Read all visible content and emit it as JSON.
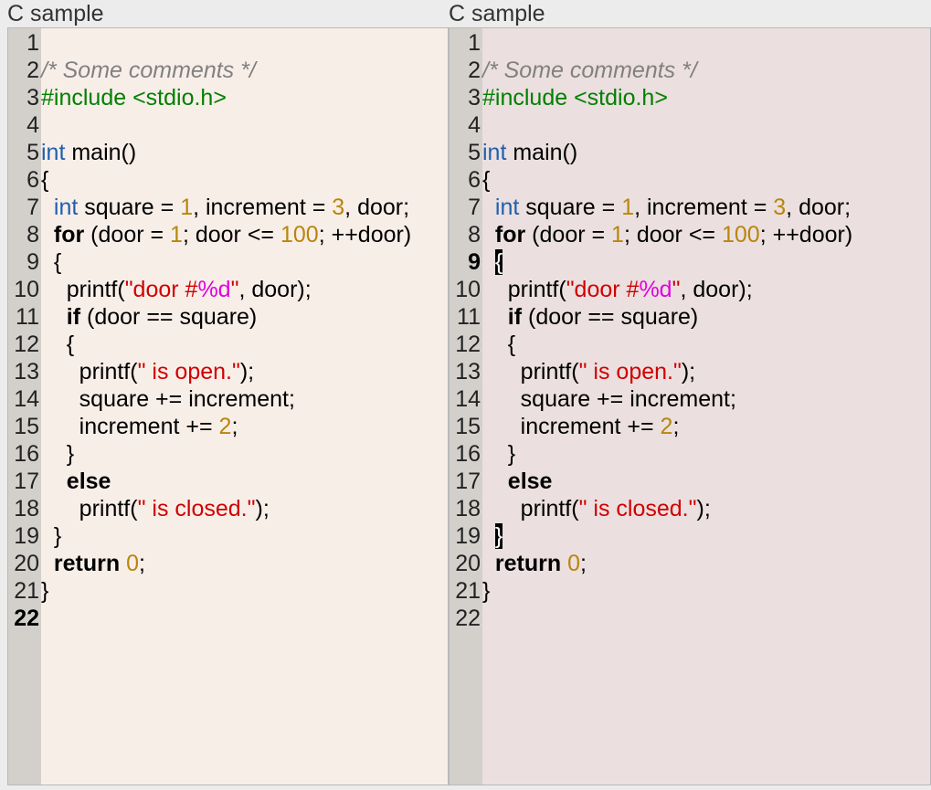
{
  "colors": {
    "window_bg": "#ececec",
    "left_editor_bg": "#f8eee8",
    "right_editor_bg": "#ebdfdf",
    "gutter_bg": "#d3d0cc",
    "keyword_type": "#1f5fad",
    "number": "#b8860b",
    "string": "#d00000",
    "format_specifier": "#e000e0",
    "comment": "#808080",
    "preprocessor": "#008000"
  },
  "panes": [
    {
      "title": "C sample",
      "current_line": 22,
      "lines": [
        [],
        [
          [
            "cmt",
            "/* Some comments */"
          ]
        ],
        [
          [
            "pre",
            "#include <stdio.h>"
          ]
        ],
        [],
        [
          [
            "kw-type",
            "int"
          ],
          [
            "tx",
            " main()"
          ]
        ],
        [
          [
            "tx",
            "{"
          ]
        ],
        [
          [
            "tx",
            "  "
          ],
          [
            "kw-type",
            "int"
          ],
          [
            "tx",
            " square = "
          ],
          [
            "num",
            "1"
          ],
          [
            "tx",
            ", increment = "
          ],
          [
            "num",
            "3"
          ],
          [
            "tx",
            ", door;"
          ]
        ],
        [
          [
            "tx",
            "  "
          ],
          [
            "kw-bold",
            "for"
          ],
          [
            "tx",
            " (door = "
          ],
          [
            "num",
            "1"
          ],
          [
            "tx",
            "; door <= "
          ],
          [
            "num",
            "100"
          ],
          [
            "tx",
            "; ++door)"
          ]
        ],
        [
          [
            "tx",
            "  {"
          ]
        ],
        [
          [
            "tx",
            "    printf("
          ],
          [
            "str",
            "\"door #"
          ],
          [
            "fmt",
            "%d"
          ],
          [
            "str",
            "\""
          ],
          [
            "tx",
            ", door);"
          ]
        ],
        [
          [
            "tx",
            "    "
          ],
          [
            "kw-bold",
            "if"
          ],
          [
            "tx",
            " (door == square)"
          ]
        ],
        [
          [
            "tx",
            "    {"
          ]
        ],
        [
          [
            "tx",
            "      printf("
          ],
          [
            "str",
            "\" is open.\""
          ],
          [
            "tx",
            ");"
          ]
        ],
        [
          [
            "tx",
            "      square += increment;"
          ]
        ],
        [
          [
            "tx",
            "      increment += "
          ],
          [
            "num",
            "2"
          ],
          [
            "tx",
            ";"
          ]
        ],
        [
          [
            "tx",
            "    }"
          ]
        ],
        [
          [
            "tx",
            "    "
          ],
          [
            "kw-bold",
            "else"
          ]
        ],
        [
          [
            "tx",
            "      printf("
          ],
          [
            "str",
            "\" is closed.\""
          ],
          [
            "tx",
            ");"
          ]
        ],
        [
          [
            "tx",
            "  }"
          ]
        ],
        [
          [
            "tx",
            "  "
          ],
          [
            "kw-bold",
            "return"
          ],
          [
            "tx",
            " "
          ],
          [
            "num",
            "0"
          ],
          [
            "tx",
            ";"
          ]
        ],
        [
          [
            "tx",
            "}"
          ]
        ],
        []
      ]
    },
    {
      "title": "C sample",
      "current_line": 9,
      "lines": [
        [],
        [
          [
            "cmt",
            "/* Some comments */"
          ]
        ],
        [
          [
            "pre",
            "#include <stdio.h>"
          ]
        ],
        [],
        [
          [
            "kw-type",
            "int"
          ],
          [
            "tx",
            " main()"
          ]
        ],
        [
          [
            "tx",
            "{"
          ]
        ],
        [
          [
            "tx",
            "  "
          ],
          [
            "kw-type",
            "int"
          ],
          [
            "tx",
            " square = "
          ],
          [
            "num",
            "1"
          ],
          [
            "tx",
            ", increment = "
          ],
          [
            "num",
            "3"
          ],
          [
            "tx",
            ", door;"
          ]
        ],
        [
          [
            "tx",
            "  "
          ],
          [
            "kw-bold",
            "for"
          ],
          [
            "tx",
            " (door = "
          ],
          [
            "num",
            "1"
          ],
          [
            "tx",
            "; door <= "
          ],
          [
            "num",
            "100"
          ],
          [
            "tx",
            "; ++door)"
          ]
        ],
        [
          [
            "tx",
            "  "
          ],
          [
            "match",
            "{"
          ]
        ],
        [
          [
            "tx",
            "    printf("
          ],
          [
            "str",
            "\"door #"
          ],
          [
            "fmt",
            "%d"
          ],
          [
            "str",
            "\""
          ],
          [
            "tx",
            ", door);"
          ]
        ],
        [
          [
            "tx",
            "    "
          ],
          [
            "kw-bold",
            "if"
          ],
          [
            "tx",
            " (door == square)"
          ]
        ],
        [
          [
            "tx",
            "    {"
          ]
        ],
        [
          [
            "tx",
            "      printf("
          ],
          [
            "str",
            "\" is open.\""
          ],
          [
            "tx",
            ");"
          ]
        ],
        [
          [
            "tx",
            "      square += increment;"
          ]
        ],
        [
          [
            "tx",
            "      increment += "
          ],
          [
            "num",
            "2"
          ],
          [
            "tx",
            ";"
          ]
        ],
        [
          [
            "tx",
            "    }"
          ]
        ],
        [
          [
            "tx",
            "    "
          ],
          [
            "kw-bold",
            "else"
          ]
        ],
        [
          [
            "tx",
            "      printf("
          ],
          [
            "str",
            "\" is closed.\""
          ],
          [
            "tx",
            ");"
          ]
        ],
        [
          [
            "tx",
            "  "
          ],
          [
            "match",
            "}"
          ]
        ],
        [
          [
            "tx",
            "  "
          ],
          [
            "kw-bold",
            "return"
          ],
          [
            "tx",
            " "
          ],
          [
            "num",
            "0"
          ],
          [
            "tx",
            ";"
          ]
        ],
        [
          [
            "tx",
            "}"
          ]
        ],
        []
      ]
    }
  ]
}
